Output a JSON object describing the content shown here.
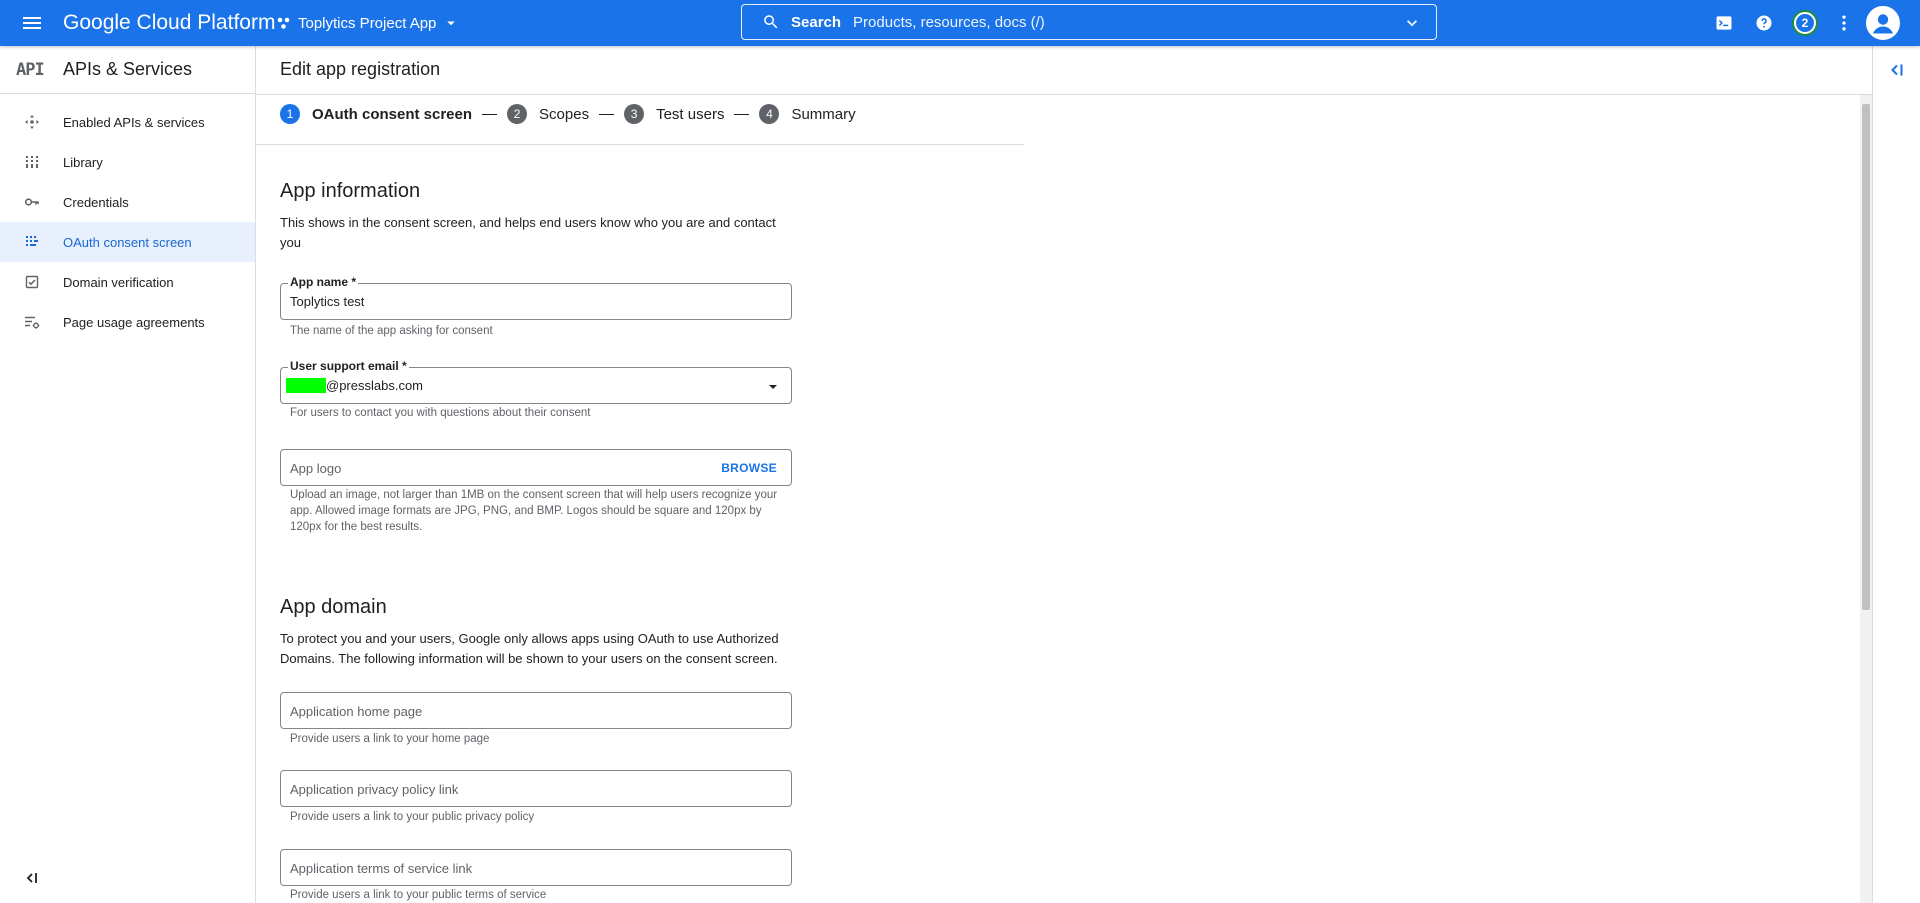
{
  "topbar": {
    "product_title": "Google Cloud Platform",
    "project_name": "Toplytics Project App",
    "search_label": "Search",
    "search_placeholder": "Products, resources, docs (/)",
    "notification_count": "2",
    "icons": [
      "menu-icon",
      "project-icon",
      "search-icon",
      "terminal-icon",
      "help-icon",
      "more-vert-icon",
      "account-icon"
    ],
    "brand_color": "#1a73e8"
  },
  "sidebar": {
    "logo": "API",
    "title": "APIs & Services",
    "items": [
      {
        "label": "Enabled APIs & services",
        "icon": "enabled-apis-icon",
        "active": false
      },
      {
        "label": "Library",
        "icon": "library-icon",
        "active": false
      },
      {
        "label": "Credentials",
        "icon": "key-icon",
        "active": false
      },
      {
        "label": "OAuth consent screen",
        "icon": "consent-icon",
        "active": true
      },
      {
        "label": "Domain verification",
        "icon": "checkbox-icon",
        "active": false
      },
      {
        "label": "Page usage agreements",
        "icon": "settings-list-icon",
        "active": false
      }
    ],
    "active_color": "#1967d2"
  },
  "page": {
    "title": "Edit app registration"
  },
  "stepper": {
    "steps": [
      {
        "number": "1",
        "label": "OAuth consent screen",
        "current": true
      },
      {
        "number": "2",
        "label": "Scopes",
        "current": false
      },
      {
        "number": "3",
        "label": "Test users",
        "current": false
      },
      {
        "number": "4",
        "label": "Summary",
        "current": false
      }
    ]
  },
  "app_information": {
    "title": "App information",
    "description": "This shows in the consent screen, and helps end users know who you are and contact you",
    "app_name": {
      "label": "App name *",
      "value": "Toplytics test",
      "hint": "The name of the app asking for consent"
    },
    "support_email": {
      "label": "User support email *",
      "value_suffix": "@presslabs.com",
      "hint": "For users to contact you with questions about their consent"
    },
    "app_logo": {
      "placeholder": "App logo",
      "action": "BROWSE",
      "hint": "Upload an image, not larger than 1MB on the consent screen that will help users recognize your app. Allowed image formats are JPG, PNG, and BMP. Logos should be square and 120px by 120px for the best results."
    }
  },
  "app_domain": {
    "title": "App domain",
    "description": "To protect you and your users, Google only allows apps using OAuth to use Authorized Domains. The following information will be shown to your users on the consent screen.",
    "home_page": {
      "placeholder": "Application home page",
      "hint": "Provide users a link to your home page"
    },
    "privacy_policy": {
      "placeholder": "Application privacy policy link",
      "hint": "Provide users a link to your public privacy policy"
    },
    "terms_of_service": {
      "placeholder": "Application terms of service link",
      "hint": "Provide users a link to your public terms of service"
    }
  }
}
